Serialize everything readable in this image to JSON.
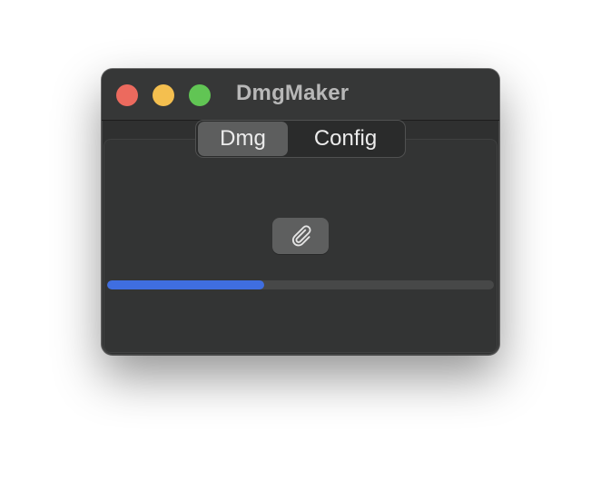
{
  "window": {
    "title": "DmgMaker"
  },
  "tabs": [
    {
      "label": "Dmg",
      "selected": true
    },
    {
      "label": "Config",
      "selected": false
    }
  ],
  "attach_button": {
    "icon": "paperclip-icon"
  },
  "progress": {
    "fraction": 0.406
  },
  "colors": {
    "window_bg": "#2f3030",
    "accent": "#3f6ee0",
    "close": "#ec6a5e",
    "minimize": "#f4bf4f",
    "maximize": "#61c554"
  }
}
